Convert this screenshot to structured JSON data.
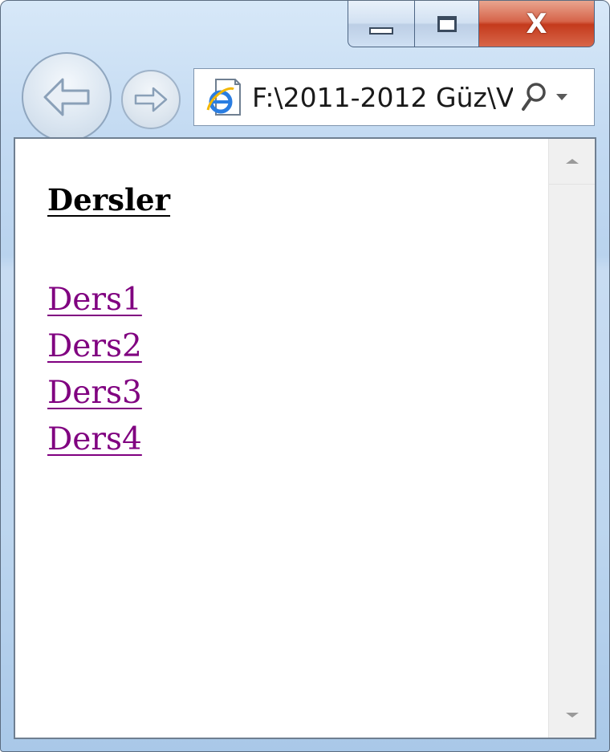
{
  "window": {
    "close_label": "X"
  },
  "address_bar": {
    "url": "F:\\2011-2012 Güz\\V"
  },
  "page": {
    "heading": "Dersler",
    "links": [
      {
        "label": "Ders1"
      },
      {
        "label": "Ders2"
      },
      {
        "label": "Ders3"
      },
      {
        "label": "Ders4"
      }
    ]
  },
  "icons": {
    "back": "back-arrow-icon",
    "forward": "forward-arrow-icon",
    "site": "internet-explorer-icon",
    "search": "search-icon",
    "dropdown": "chevron-down-icon",
    "minimize": "minimize-icon",
    "maximize": "maximize-icon",
    "close": "close-icon"
  },
  "colors": {
    "visited_link": "#800080",
    "close_button": "#c43a1c",
    "frame": "#bdd6ef"
  }
}
